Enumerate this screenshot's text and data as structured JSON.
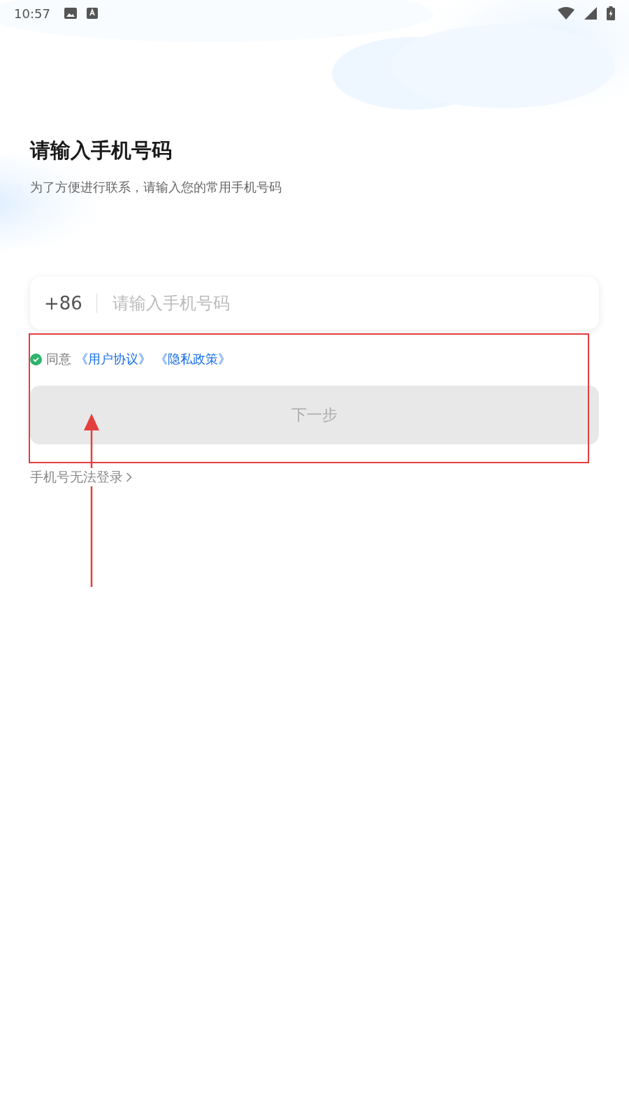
{
  "status_bar": {
    "time": "10:57"
  },
  "title": "请输入手机号码",
  "subtitle": "为了方便进行联系，请输入您的常用手机号码",
  "phone_field": {
    "country_code": "+86",
    "placeholder": "请输入手机号码"
  },
  "agreement": {
    "checked": true,
    "prefix": "同意",
    "links": [
      "《用户协议》",
      "《隐私政策》"
    ]
  },
  "next_button": {
    "label": "下一步",
    "disabled": true
  },
  "help_link": "手机号无法登录"
}
